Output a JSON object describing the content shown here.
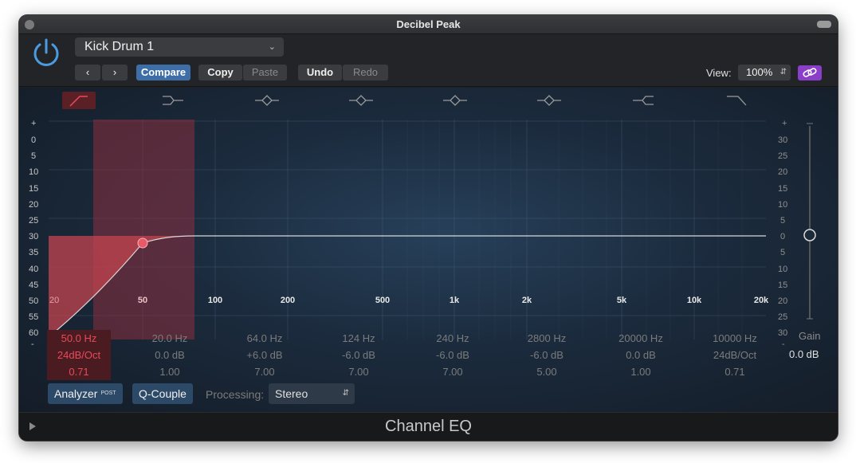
{
  "window": {
    "title": "Decibel Peak"
  },
  "header": {
    "preset": "Kick Drum 1",
    "compare_label": "Compare",
    "copy_label": "Copy",
    "paste_label": "Paste",
    "undo_label": "Undo",
    "redo_label": "Redo",
    "view_label": "View:",
    "view_value": "100%"
  },
  "axis_left": [
    "+",
    "0",
    "5",
    "10",
    "15",
    "20",
    "25",
    "30",
    "35",
    "40",
    "45",
    "50",
    "55",
    "60",
    "-"
  ],
  "axis_right": [
    "+",
    "30",
    "25",
    "20",
    "15",
    "10",
    "5",
    "0",
    "5",
    "10",
    "15",
    "20",
    "25",
    "30",
    "-"
  ],
  "freq_labels": [
    "20",
    "50",
    "100",
    "200",
    "500",
    "1k",
    "2k",
    "5k",
    "10k",
    "20k"
  ],
  "bands": [
    {
      "freq": "50.0 Hz",
      "gain": "24dB/Oct",
      "q": "0.71",
      "icon": "low-cut-icon"
    },
    {
      "freq": "20.0 Hz",
      "gain": "0.0 dB",
      "q": "1.00",
      "icon": "low-shelf-icon"
    },
    {
      "freq": "64.0 Hz",
      "gain": "+6.0 dB",
      "q": "7.00",
      "icon": "peak-icon"
    },
    {
      "freq": "124 Hz",
      "gain": "-6.0 dB",
      "q": "7.00",
      "icon": "peak-icon"
    },
    {
      "freq": "240 Hz",
      "gain": "-6.0 dB",
      "q": "7.00",
      "icon": "peak-icon"
    },
    {
      "freq": "2800 Hz",
      "gain": "-6.0 dB",
      "q": "5.00",
      "icon": "peak-icon"
    },
    {
      "freq": "20000 Hz",
      "gain": "0.0 dB",
      "q": "1.00",
      "icon": "high-shelf-icon"
    },
    {
      "freq": "10000 Hz",
      "gain": "24dB/Oct",
      "q": "0.71",
      "icon": "high-cut-icon"
    }
  ],
  "gain": {
    "label": "Gain",
    "value": "0.0 dB"
  },
  "bottom": {
    "analyzer_label": "Analyzer",
    "analyzer_badge": "POST",
    "qcouple_label": "Q-Couple",
    "processing_label": "Processing:",
    "processing_value": "Stereo"
  },
  "footer": {
    "title": "Channel EQ"
  },
  "colors": {
    "accent": "#3d6ea8",
    "active_band": "#e84a5a",
    "link": "#8b3fc9"
  }
}
